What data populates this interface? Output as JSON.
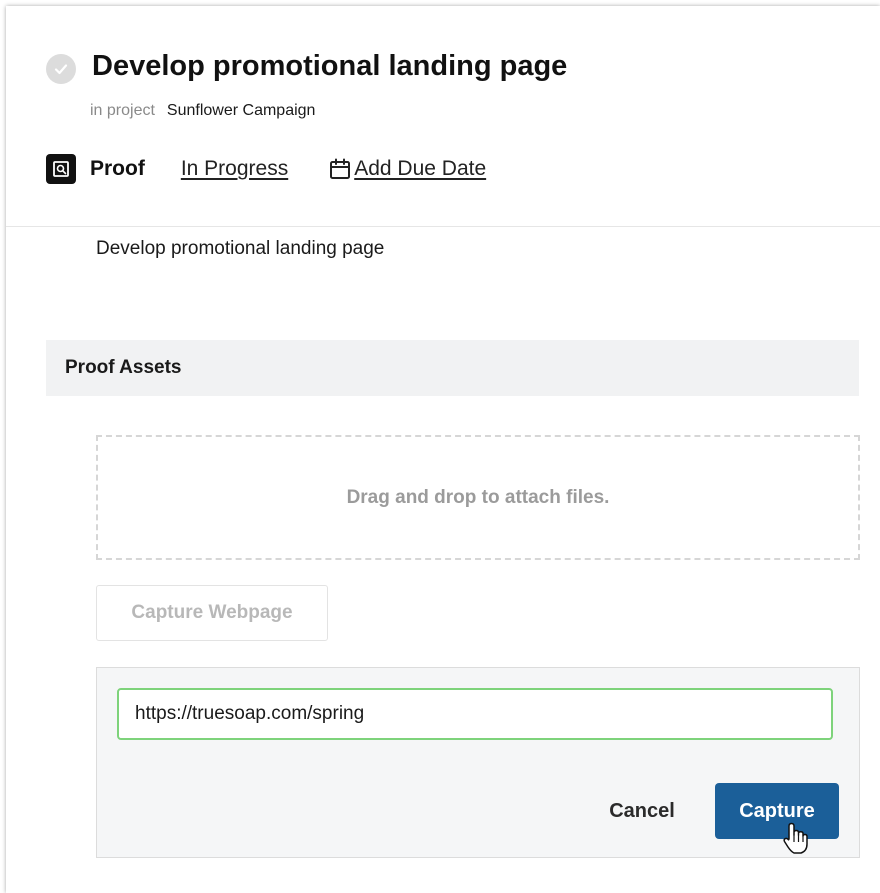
{
  "task": {
    "title": "Develop promotional landing page",
    "project_prefix": "in project",
    "project_name": "Sunflower Campaign",
    "type_label": "Proof",
    "status": "In Progress",
    "due_date_label": "Add Due Date",
    "description": "Develop promotional landing page"
  },
  "assets": {
    "section_title": "Proof Assets",
    "dropzone_text": "Drag and drop to attach files.",
    "capture_webpage_label": "Capture Webpage"
  },
  "capture_form": {
    "url_value": "https://truesoap.com/spring",
    "cancel_label": "Cancel",
    "capture_label": "Capture"
  },
  "colors": {
    "accent": "#1b5f99",
    "input_focus_border": "#7ed37b",
    "section_bg": "#f1f2f3",
    "panel_bg": "#f5f6f7"
  },
  "icons": [
    "check-icon",
    "proof-icon",
    "calendar-icon",
    "hand-cursor-icon"
  ]
}
